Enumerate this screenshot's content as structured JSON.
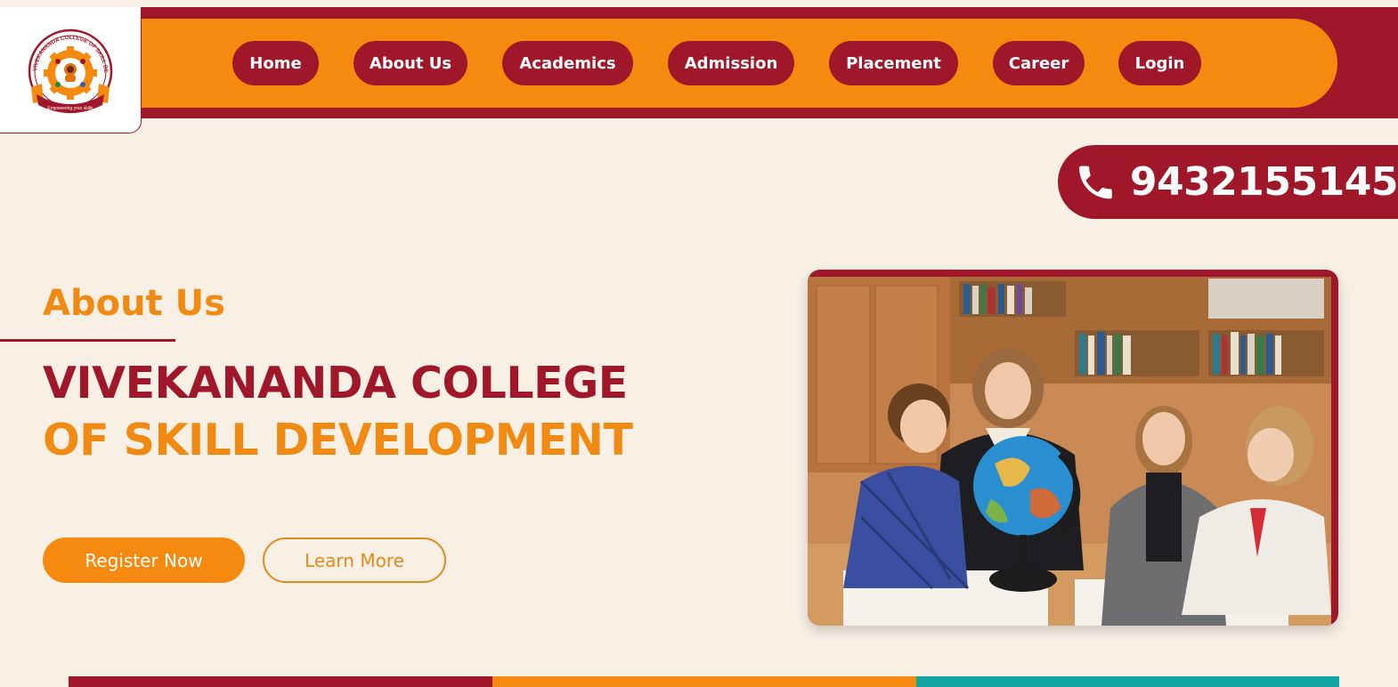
{
  "logo": {
    "ring_text": "VIVEKANANDA COLLEGE OF SKILL DEVELOPMENT",
    "tagline": "Empowering your skills"
  },
  "nav": {
    "items": [
      {
        "label": "Home"
      },
      {
        "label": "About Us"
      },
      {
        "label": "Academics"
      },
      {
        "label": "Admission"
      },
      {
        "label": "Placement"
      },
      {
        "label": "Career"
      },
      {
        "label": "Login"
      }
    ]
  },
  "contact": {
    "phone": "9432155145",
    "icon": "phone-icon"
  },
  "hero": {
    "eyebrow": "About Us",
    "title_line1": "VIVEKANANDA COLLEGE",
    "title_line2": "OF SKILL DEVELOPMENT",
    "register_label": "Register Now",
    "learn_label": "Learn More"
  },
  "colors": {
    "maroon": "#a0172a",
    "orange": "#f58a0e",
    "cream": "#f8f0e5",
    "teal": "#14a5a5"
  }
}
